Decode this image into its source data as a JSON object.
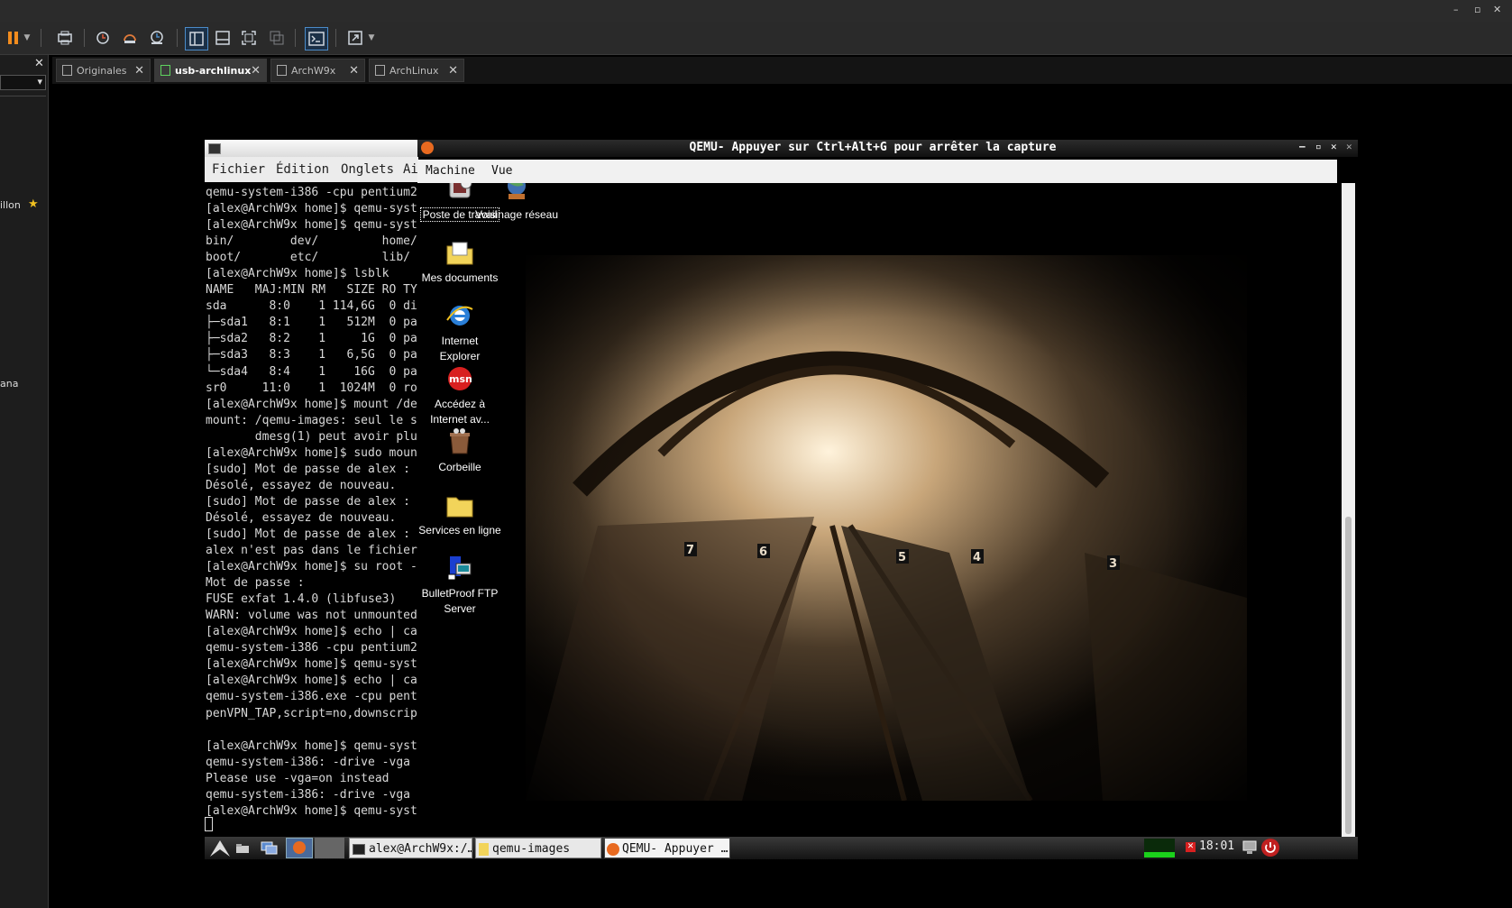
{
  "host": {
    "window_controls": [
      "–",
      "▫",
      "✕"
    ],
    "toolbar_icons": [
      "pause-icon",
      "dropdown-icon",
      "send-keys-icon",
      "snapshot-icon",
      "revert-icon",
      "snapshot-manager-icon",
      "sidebar-icon",
      "thumbnail-icon",
      "fullscreen-icon",
      "unity-icon",
      "console-icon",
      "stretch-icon",
      "dropdown-icon"
    ]
  },
  "left_panel": {
    "close_glyph": "✕",
    "dropdown_glyph": "▾",
    "item1": "illon",
    "item1_star": "★",
    "item2": "ana"
  },
  "tabs": [
    {
      "label": "Originales",
      "active": false
    },
    {
      "label": "usb-archlinux",
      "active": true
    },
    {
      "label": "ArchW9x",
      "active": false
    },
    {
      "label": "ArchLinux",
      "active": false
    }
  ],
  "tab_close": "✕",
  "terminal": {
    "menu": [
      "Fichier",
      "Édition",
      "Onglets",
      "Ai"
    ],
    "lines": [
      "qemu-system-i386 -cpu pentium2",
      "[alex@ArchW9x home]$ qemu-syst",
      "[alex@ArchW9x home]$ qemu-syst",
      "bin/        dev/         home/",
      "boot/       etc/         lib/",
      "[alex@ArchW9x home]$ lsblk",
      "NAME   MAJ:MIN RM   SIZE RO TY",
      "sda      8:0    1 114,6G  0 di",
      "├─sda1   8:1    1   512M  0 pa",
      "├─sda2   8:2    1     1G  0 pa",
      "├─sda3   8:3    1   6,5G  0 pa",
      "└─sda4   8:4    1    16G  0 pa",
      "sr0     11:0    1  1024M  0 ro",
      "[alex@ArchW9x home]$ mount /de",
      "mount: /qemu-images: seul le s",
      "       dmesg(1) peut avoir plu",
      "[alex@ArchW9x home]$ sudo moun",
      "[sudo] Mot de passe de alex :",
      "Désolé, essayez de nouveau.",
      "[sudo] Mot de passe de alex :",
      "Désolé, essayez de nouveau.",
      "[sudo] Mot de passe de alex :",
      "alex n'est pas dans le fichier",
      "[alex@ArchW9x home]$ su root -",
      "Mot de passe :",
      "FUSE exfat 1.4.0 (libfuse3)",
      "WARN: volume was not unmounted",
      "[alex@ArchW9x home]$ echo | ca",
      "qemu-system-i386 -cpu pentium2",
      "[alex@ArchW9x home]$ qemu-syst",
      "[alex@ArchW9x home]$ echo | ca",
      "qemu-system-i386.exe -cpu pent",
      "penVPN_TAP,script=no,downscrip",
      "",
      "[alex@ArchW9x home]$ qemu-syst",
      "qemu-system-i386: -drive -vga",
      "Please use -vga=on instead",
      "qemu-system-i386: -drive -vga",
      "[alex@ArchW9x home]$ qemu-syst"
    ]
  },
  "qemu": {
    "title": "QEMU- Appuyer sur Ctrl+Alt+G pour arrêter la capture",
    "controls": [
      "–",
      "▫",
      "✕"
    ],
    "outer_close": "✕",
    "menu": [
      "Machine",
      "Vue"
    ]
  },
  "desktop_icons": [
    {
      "label": "Poste de travail",
      "icon": "my-computer-icon"
    },
    {
      "label": "Voisinage réseau",
      "icon": "network-neighborhood-icon"
    },
    {
      "label": "Mes documents",
      "icon": "my-documents-icon"
    },
    {
      "label": "Internet Explorer",
      "icon": "internet-explorer-icon"
    },
    {
      "label": "Accédez à Internet av...",
      "icon": "msn-icon"
    },
    {
      "label": "Corbeille",
      "icon": "recycle-bin-icon"
    },
    {
      "label": "Services en ligne",
      "icon": "online-services-folder-icon"
    },
    {
      "label": "BulletProof FTP Server",
      "icon": "ftp-server-icon"
    }
  ],
  "wallpaper": {
    "platform_numbers": [
      "7",
      "6",
      "5",
      "4",
      "3"
    ],
    "icon": "railway-station-photo"
  },
  "taskbar": {
    "windows": [
      {
        "label": "alex@ArchW9x:/…",
        "icon": "terminal-icon"
      },
      {
        "label": "qemu-images",
        "icon": "folder-icon"
      },
      {
        "label": "QEMU- Appuyer …",
        "icon": "qemu-icon"
      }
    ],
    "time": "18:01"
  },
  "colors": {
    "host_bg": "#2b2b2b",
    "accent": "#4b8bc8",
    "wallpaper_tone": "#c8a67a"
  }
}
